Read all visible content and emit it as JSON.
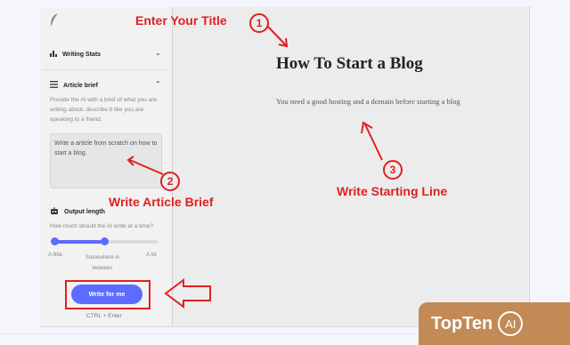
{
  "sidebar": {
    "writing_stats_label": "Writing Stats",
    "article_brief_label": "Article brief",
    "article_brief_help": "Provide the AI with a brief of what you are writing about, describe it like you are speaking to a friend.",
    "article_brief_value": "Write a article from scratch on how to start a blog.",
    "output_length_label": "Output length",
    "output_length_help": "How much should the AI write at a time?",
    "slider": {
      "value": 0.5,
      "labels": [
        "A little",
        "Somewhere in between",
        "A lot"
      ]
    },
    "write_button": "Write for me",
    "shortcut": "CTRL + Enter"
  },
  "document": {
    "title": "How To Start a Blog",
    "starting_line": "You need a good hosting and a domain before starting a blog"
  },
  "annotations": {
    "title_hint": "Enter Your Title",
    "brief_hint": "Write Article Brief",
    "start_hint": "Write Starting Line",
    "num1": "1",
    "num2": "2",
    "num3": "3"
  },
  "watermark": {
    "brand": "TopTen",
    "ai": "AI"
  },
  "colors": {
    "accent": "#5b6cff",
    "annotation": "#e02020",
    "badge": "#c28a56"
  }
}
